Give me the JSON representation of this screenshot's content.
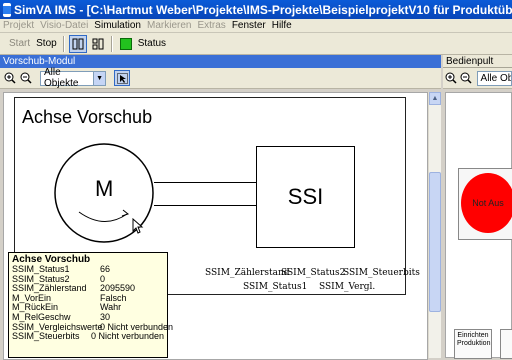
{
  "window": {
    "title": "SimVA IMS - [C:\\Hartmut Weber\\Projekte\\IMS-Projekte\\BeispielprojektV10 für Produktübersicht\\Beispielprojekt"
  },
  "menu": {
    "items": [
      {
        "label": "Projekt",
        "enabled": false
      },
      {
        "label": "Visio-Datei",
        "enabled": false
      },
      {
        "label": "Simulation",
        "enabled": true
      },
      {
        "label": "Markieren",
        "enabled": false
      },
      {
        "label": "Extras",
        "enabled": false
      },
      {
        "label": "Fenster",
        "enabled": true
      },
      {
        "label": "Hilfe",
        "enabled": true
      }
    ]
  },
  "toolbar": {
    "start_label": "Start",
    "stop_label": "Stop",
    "status_label": "Status",
    "status_color": "#22c11e"
  },
  "vorschub_panel": {
    "title": "Vorschub-Modul",
    "filter_value": "Alle Objekte",
    "diagram_title": "Achse Vorschub",
    "motor_label": "M",
    "ssi_label": "SSI",
    "signals_row1": [
      "SSIM_Zählerstand",
      "SSIM_Status2",
      "SSIM_Steuerbits"
    ],
    "signals_row2": [
      "SSIM_Status1",
      "SSIM_Vergl."
    ]
  },
  "tooltip": {
    "title": "Achse Vorschub",
    "rows": [
      {
        "key": "SSIM_Status1",
        "value": "66"
      },
      {
        "key": "SSIM_Status2",
        "value": "0"
      },
      {
        "key": "SSIM_Zählerstand",
        "value": "2095590"
      },
      {
        "key": "M_VorEin",
        "value": "Falsch"
      },
      {
        "key": "M_RückEin",
        "value": "Wahr"
      },
      {
        "key": "M_RelGeschw",
        "value": "30"
      },
      {
        "key": "SSIM_Vergleichswerte",
        "value": "0 Nicht verbunden"
      },
      {
        "key": "SSIM_Steuerbits",
        "value": "0 Nicht verbunden"
      }
    ]
  },
  "bedienpult_panel": {
    "title": "Bedienpult",
    "filter_value": "Alle Obje",
    "button_label": "Not Aus",
    "button_color": "#ff0000",
    "bottom_box_label": "Einrichten Produktion"
  }
}
